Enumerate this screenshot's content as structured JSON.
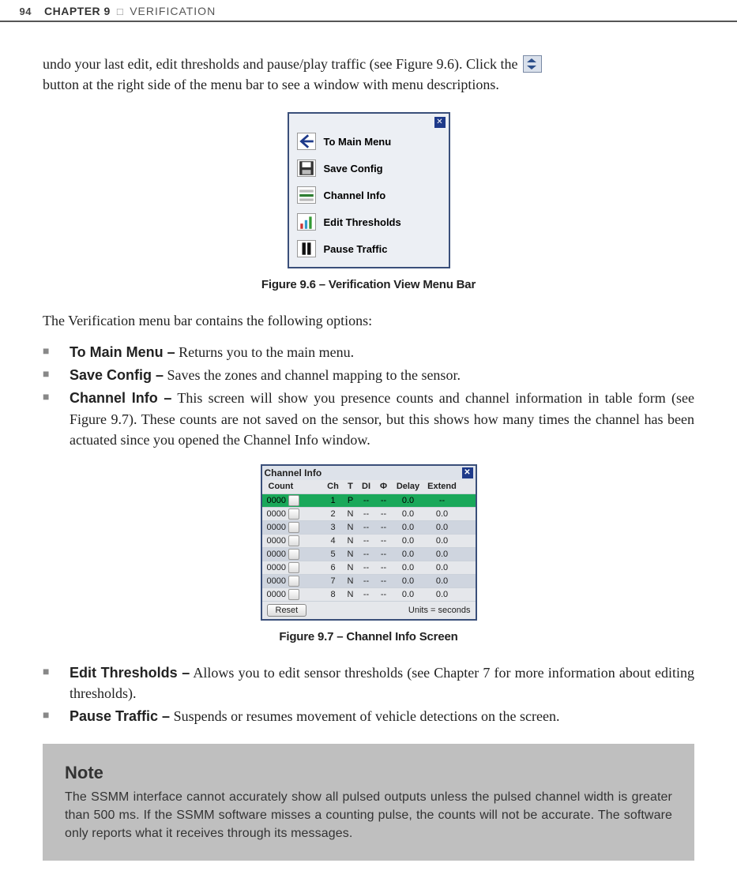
{
  "header": {
    "page_num": "94",
    "chapter_label": "CHAPTER 9",
    "separator": "□",
    "chapter_title": "VERIFICATION"
  },
  "p1": "undo your last edit, edit thresholds and pause/play traffic (see Figure 9.6). Click the ",
  "p1b": "button at the right side of the menu bar to see a window with menu descriptions.",
  "fig96": {
    "items": [
      {
        "name": "to-main-menu",
        "label": "To Main Menu"
      },
      {
        "name": "save-config",
        "label": "Save Config"
      },
      {
        "name": "channel-info",
        "label": "Channel Info"
      },
      {
        "name": "edit-thresholds",
        "label": "Edit Thresholds"
      },
      {
        "name": "pause-traffic",
        "label": "Pause Traffic"
      }
    ],
    "caption": "Figure 9.6 – Verification View Menu Bar"
  },
  "p2": "The Verification menu bar contains the following options:",
  "bullets1": [
    {
      "label": "To Main Menu –",
      "text": " Returns you to the main menu."
    },
    {
      "label": "Save Config –",
      "text": " Saves the zones and channel mapping to the sensor."
    },
    {
      "label": "Channel Info –",
      "text": " This screen will show you presence counts and channel information in table form (see Figure 9.7). These counts are not saved on the sensor, but this shows how many times the channel has been actuated since you opened the Channel Info window."
    }
  ],
  "fig97": {
    "title": "Channel Info",
    "headers": [
      "Count",
      "",
      "Ch",
      "T",
      "DI",
      "Φ",
      "Delay",
      "Extend"
    ],
    "rows": [
      {
        "count": "0000",
        "ch": "1",
        "t": "P",
        "di": "--",
        "phi": "--",
        "delay": "0.0",
        "extend": "--",
        "class": "hi"
      },
      {
        "count": "0000",
        "ch": "2",
        "t": "N",
        "di": "--",
        "phi": "--",
        "delay": "0.0",
        "extend": "0.0",
        "class": ""
      },
      {
        "count": "0000",
        "ch": "3",
        "t": "N",
        "di": "--",
        "phi": "--",
        "delay": "0.0",
        "extend": "0.0",
        "class": "alt"
      },
      {
        "count": "0000",
        "ch": "4",
        "t": "N",
        "di": "--",
        "phi": "--",
        "delay": "0.0",
        "extend": "0.0",
        "class": ""
      },
      {
        "count": "0000",
        "ch": "5",
        "t": "N",
        "di": "--",
        "phi": "--",
        "delay": "0.0",
        "extend": "0.0",
        "class": "alt"
      },
      {
        "count": "0000",
        "ch": "6",
        "t": "N",
        "di": "--",
        "phi": "--",
        "delay": "0.0",
        "extend": "0.0",
        "class": ""
      },
      {
        "count": "0000",
        "ch": "7",
        "t": "N",
        "di": "--",
        "phi": "--",
        "delay": "0.0",
        "extend": "0.0",
        "class": "alt"
      },
      {
        "count": "0000",
        "ch": "8",
        "t": "N",
        "di": "--",
        "phi": "--",
        "delay": "0.0",
        "extend": "0.0",
        "class": ""
      }
    ],
    "reset": "Reset",
    "units": "Units = seconds",
    "caption": "Figure 9.7 – Channel Info Screen"
  },
  "bullets2": [
    {
      "label": "Edit Thresholds –",
      "text": " Allows you to edit sensor thresholds (see Chapter 7 for more information about editing thresholds)."
    },
    {
      "label": "Pause Traffic –",
      "text": " Suspends or resumes movement of vehicle detections on the screen."
    }
  ],
  "note": {
    "title": "Note",
    "text": "The SSMM interface cannot accurately show all pulsed outputs unless the pulsed channel width is greater than 500 ms. If the SSMM software misses a counting pulse, the counts will not be accurate. The software only reports what it receives through its messages."
  }
}
